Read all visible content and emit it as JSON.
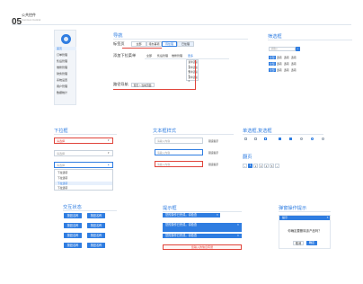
{
  "header": {
    "number": "05",
    "title": "公共控件",
    "subtitle": "Common Control"
  },
  "nav": {
    "title": "导航",
    "tab_label": "标签页",
    "tabs": [
      "全部",
      "待办事项",
      "待处理",
      "已处理"
    ],
    "dropdown_label": "添加下拉菜单",
    "dropdown_items": [
      "全部",
      "售后管理",
      "维修管理",
      "更多"
    ],
    "dropdown_menu": [
      "菜单选项1",
      "菜单选项2",
      "菜单选项3",
      "菜单选项4"
    ],
    "breadcrumb_label": "路径导航",
    "breadcrumb": "首页 > 当前页面"
  },
  "filter": {
    "title": "筛选框",
    "search_placeholder": "请输入",
    "rows": [
      [
        "全部",
        "选项",
        "选项",
        "选项"
      ],
      [
        "全部",
        "选项",
        "选项",
        "选项"
      ],
      [
        "全部",
        "选项",
        "选项",
        "选项"
      ]
    ]
  },
  "sidebar": {
    "items": [
      "首页",
      "订单管理",
      "售后管理",
      "维修管理",
      "财务管理",
      "系统设置",
      "用户管理",
      "数据统计"
    ]
  },
  "select": {
    "title": "下拉框",
    "placeholder": "请选择",
    "error_placeholder": "请选择",
    "options": [
      "下拉选项",
      "下拉选项",
      "下拉选项",
      "下拉选项"
    ]
  },
  "text": {
    "title": "文本框样式",
    "placeholder": "请输入内容",
    "hints": [
      "错误提示",
      "错误提示",
      "错误提示"
    ]
  },
  "choice": {
    "title": "单选框,复选框",
    "pager_title": "翻页",
    "pages": [
      "1",
      "2",
      "3",
      "4",
      "5"
    ]
  },
  "buttons": {
    "title": "交互状态",
    "rows": [
      [
        "按钮名称",
        "按钮名称"
      ],
      [
        "按钮名称",
        "按钮名称"
      ],
      [
        "按钮名称",
        "按钮名称"
      ],
      [
        "按钮名称",
        "按钮名称"
      ]
    ]
  },
  "prompt": {
    "title": "提示框",
    "messages": [
      "您的操作已完成，请检查",
      "您的操作已完成，请检查",
      "您的操作已完成，请检查"
    ],
    "error_message": "您输入的信息有误"
  },
  "dialog": {
    "title": "弹窗操作提示",
    "header": "提示",
    "message": "你确定要删除该产品吗？",
    "cancel": "取消",
    "ok": "确定"
  }
}
